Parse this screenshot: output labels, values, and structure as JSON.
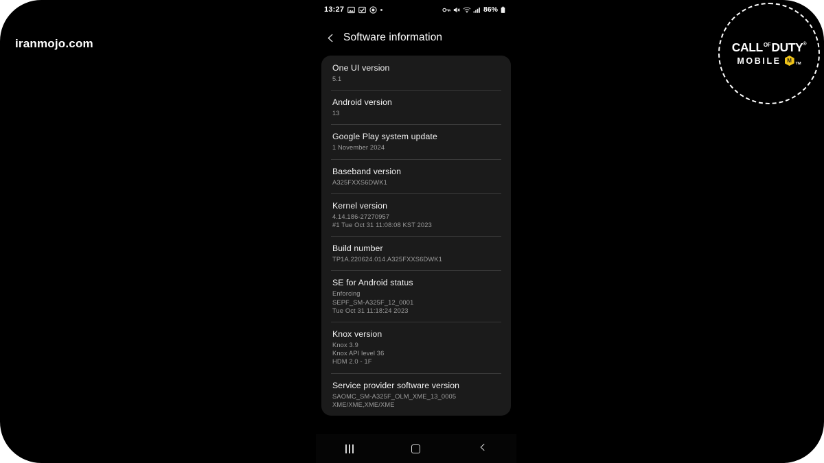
{
  "watermark": "iranmojo.com",
  "statusbar": {
    "time": "13:27",
    "battery_percent": "86%",
    "left_icons": [
      "image-icon",
      "checkbox-icon",
      "record-icon",
      "dot-icon"
    ],
    "right_icons": [
      "vpn-key-icon",
      "mute-icon",
      "wifi-icon",
      "signal-icon",
      "battery-icon"
    ]
  },
  "header": {
    "back_label": "Back",
    "title": "Software information"
  },
  "list": {
    "items": [
      {
        "title": "One UI version",
        "lines": [
          "5.1"
        ]
      },
      {
        "title": "Android version",
        "lines": [
          "13"
        ]
      },
      {
        "title": "Google Play system update",
        "lines": [
          "1 November 2024"
        ]
      },
      {
        "title": "Baseband version",
        "lines": [
          "A325FXXS6DWK1"
        ]
      },
      {
        "title": "Kernel version",
        "lines": [
          "4.14.186-27270957",
          "#1 Tue Oct 31 11:08:08 KST 2023"
        ]
      },
      {
        "title": "Build number",
        "lines": [
          "TP1A.220624.014.A325FXXS6DWK1"
        ]
      },
      {
        "title": "SE for Android status",
        "lines": [
          "Enforcing",
          "SEPF_SM-A325F_12_0001",
          "Tue Oct 31 11:18:24 2023"
        ]
      },
      {
        "title": "Knox version",
        "lines": [
          "Knox 3.9",
          "Knox API level 36",
          "HDM 2.0 - 1F"
        ]
      },
      {
        "title": "Service provider software version",
        "lines": [
          "SAOMC_SM-A325F_OLM_XME_13_0005",
          "XME/XME,XME/XME"
        ]
      }
    ]
  },
  "navbar": {
    "recents_label": "Recents",
    "home_label": "Home",
    "back_label": "Back"
  },
  "logo": {
    "line1_a": "CALL",
    "line1_of": "OF",
    "line1_b": "DUTY",
    "registered": "®",
    "line2": "MOBILE",
    "badge_letter": "M",
    "trademark": "TM"
  },
  "colors": {
    "background": "#000000",
    "page": "#ffffff",
    "card": "#1b1b1b",
    "divider": "#3a3a3a",
    "title_text": "#f3f3f3",
    "sub_text": "#9d9d9d",
    "accent_gold": "#f0c419"
  }
}
